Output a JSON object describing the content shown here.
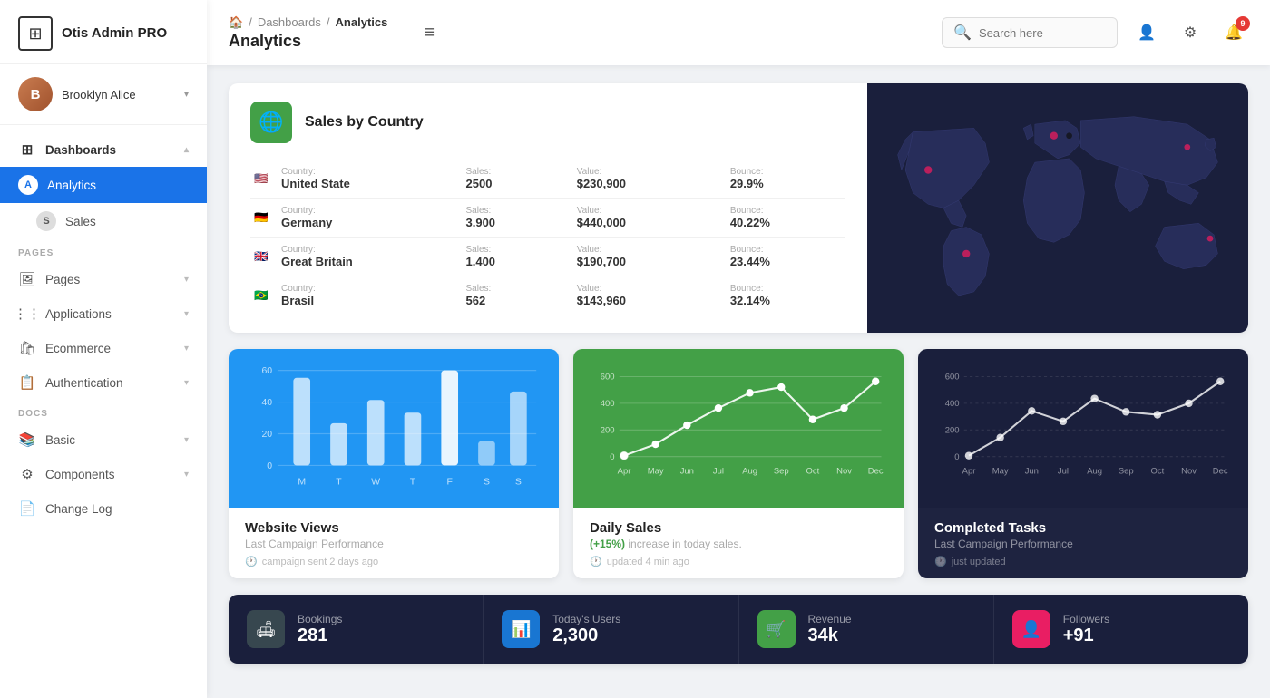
{
  "sidebar": {
    "logo": {
      "text": "Otis Admin PRO",
      "icon": "⊞"
    },
    "user": {
      "name": "Brooklyn Alice",
      "avatar_initials": "B"
    },
    "nav": [
      {
        "id": "dashboards",
        "label": "Dashboards",
        "icon": "⊞",
        "type": "parent",
        "expanded": true
      },
      {
        "id": "analytics",
        "label": "Analytics",
        "icon": "A",
        "type": "child",
        "active": true
      },
      {
        "id": "sales",
        "label": "Sales",
        "icon": "S",
        "type": "child",
        "active": false
      }
    ],
    "sections": [
      {
        "label": "PAGES",
        "items": [
          {
            "id": "pages",
            "label": "Pages",
            "icon": "🖼"
          },
          {
            "id": "applications",
            "label": "Applications",
            "icon": "⋮⋮"
          },
          {
            "id": "ecommerce",
            "label": "Ecommerce",
            "icon": "🛍"
          },
          {
            "id": "authentication",
            "label": "Authentication",
            "icon": "📋"
          }
        ]
      },
      {
        "label": "DOCS",
        "items": [
          {
            "id": "basic",
            "label": "Basic",
            "icon": "📚"
          },
          {
            "id": "components",
            "label": "Components",
            "icon": "⚙"
          },
          {
            "id": "changelog",
            "label": "Change Log",
            "icon": "📄"
          }
        ]
      }
    ]
  },
  "header": {
    "breadcrumb": [
      "🏠",
      "Dashboards",
      "Analytics"
    ],
    "title": "Analytics",
    "hamburger": "≡",
    "search_placeholder": "Search here",
    "notif_count": "9"
  },
  "sales_by_country": {
    "title": "Sales by Country",
    "rows": [
      {
        "flag": "🇺🇸",
        "country_label": "Country:",
        "country": "United State",
        "sales_label": "Sales:",
        "sales": "2500",
        "value_label": "Value:",
        "value": "$230,900",
        "bounce_label": "Bounce:",
        "bounce": "29.9%"
      },
      {
        "flag": "🇩🇪",
        "country_label": "Country:",
        "country": "Germany",
        "sales_label": "Sales:",
        "sales": "3.900",
        "value_label": "Value:",
        "value": "$440,000",
        "bounce_label": "Bounce:",
        "bounce": "40.22%"
      },
      {
        "flag": "🇬🇧",
        "country_label": "Country:",
        "country": "Great Britain",
        "sales_label": "Sales:",
        "sales": "1.400",
        "value_label": "Value:",
        "value": "$190,700",
        "bounce_label": "Bounce:",
        "bounce": "23.44%"
      },
      {
        "flag": "🇧🇷",
        "country_label": "Country:",
        "country": "Brasil",
        "sales_label": "Sales:",
        "sales": "562",
        "value_label": "Value:",
        "value": "$143,960",
        "bounce_label": "Bounce:",
        "bounce": "32.14%"
      }
    ]
  },
  "charts": {
    "website_views": {
      "title": "Website Views",
      "subtitle": "Last Campaign Performance",
      "footer": "campaign sent 2 days ago",
      "y_labels": [
        "60",
        "40",
        "20",
        "0"
      ],
      "x_labels": [
        "M",
        "T",
        "W",
        "T",
        "F",
        "S",
        "S"
      ],
      "bars": [
        55,
        25,
        40,
        30,
        60,
        15,
        45
      ]
    },
    "daily_sales": {
      "title": "Daily Sales",
      "subtitle_prefix": "(+15%)",
      "subtitle_suffix": "increase in today sales.",
      "footer": "updated 4 min ago",
      "y_labels": [
        "600",
        "400",
        "200",
        "0"
      ],
      "x_labels": [
        "Apr",
        "May",
        "Jun",
        "Jul",
        "Aug",
        "Sep",
        "Oct",
        "Nov",
        "Dec"
      ],
      "points": [
        10,
        80,
        200,
        310,
        430,
        480,
        260,
        310,
        500
      ]
    },
    "completed_tasks": {
      "title": "Completed Tasks",
      "subtitle": "Last Campaign Performance",
      "footer": "just updated",
      "y_labels": [
        "600",
        "400",
        "200",
        "0"
      ],
      "x_labels": [
        "Apr",
        "May",
        "Jun",
        "Jul",
        "Aug",
        "Sep",
        "Oct",
        "Nov",
        "Dec"
      ],
      "points": [
        20,
        120,
        280,
        220,
        380,
        300,
        280,
        340,
        500
      ]
    }
  },
  "bottom_stats": [
    {
      "id": "bookings",
      "icon": "🛋",
      "icon_bg": "#37474f",
      "label": "Bookings",
      "value": "281"
    },
    {
      "id": "today_users",
      "icon": "📊",
      "icon_bg": "#1976d2",
      "label": "Today's Users",
      "value": "2,300"
    },
    {
      "id": "revenue",
      "icon": "🛒",
      "icon_bg": "#43a047",
      "label": "Revenue",
      "value": "34k"
    },
    {
      "id": "followers",
      "icon": "👤",
      "icon_bg": "#e91e63",
      "label": "Followers",
      "value": "+91"
    }
  ]
}
